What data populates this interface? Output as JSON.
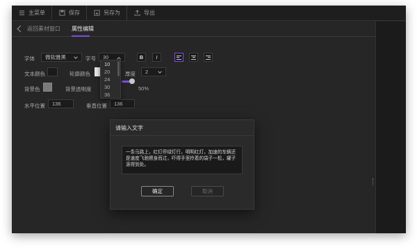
{
  "toolbar": {
    "items": [
      {
        "label": "主菜单",
        "icon": "menu-icon"
      },
      {
        "label": "保存",
        "icon": "save-icon"
      },
      {
        "label": "另存为",
        "icon": "save-as-icon"
      },
      {
        "label": "导出",
        "icon": "export-icon"
      }
    ]
  },
  "subnav": {
    "back_label": "返回素材窗口",
    "active_tab": "属性编辑"
  },
  "props": {
    "font_label": "字体",
    "font_value": "微软雅黑",
    "size_label": "字号",
    "size_value": "30",
    "bold": "B",
    "italic": "I",
    "text_color_label": "文本颜色",
    "outline_color_label": "轮廓颜色",
    "outline_width_label": "厚度",
    "outline_width_value": "2",
    "bg_color_label": "背景色",
    "bg_opacity_label": "背景透明度",
    "bg_opacity_value": "50%",
    "bg_opacity_fraction": 0.5,
    "x_label": "水平位置",
    "x_value": "136",
    "y_label": "垂直位置",
    "y_value": "136"
  },
  "size_dropdown": {
    "options": [
      "10",
      "20",
      "24",
      "30",
      "36"
    ]
  },
  "colors": {
    "accent": "#7b4fe0",
    "bg": "#262626"
  },
  "modal": {
    "title": "请输入文字",
    "text": "一条马路上，红灯停绿灯行，明明红灯，加速的车辆还是速度飞驰擦身而过，吓得手里拎着的袋子一松，罐子滚得到处。",
    "ok_label": "确定",
    "cancel_label": "取消"
  }
}
